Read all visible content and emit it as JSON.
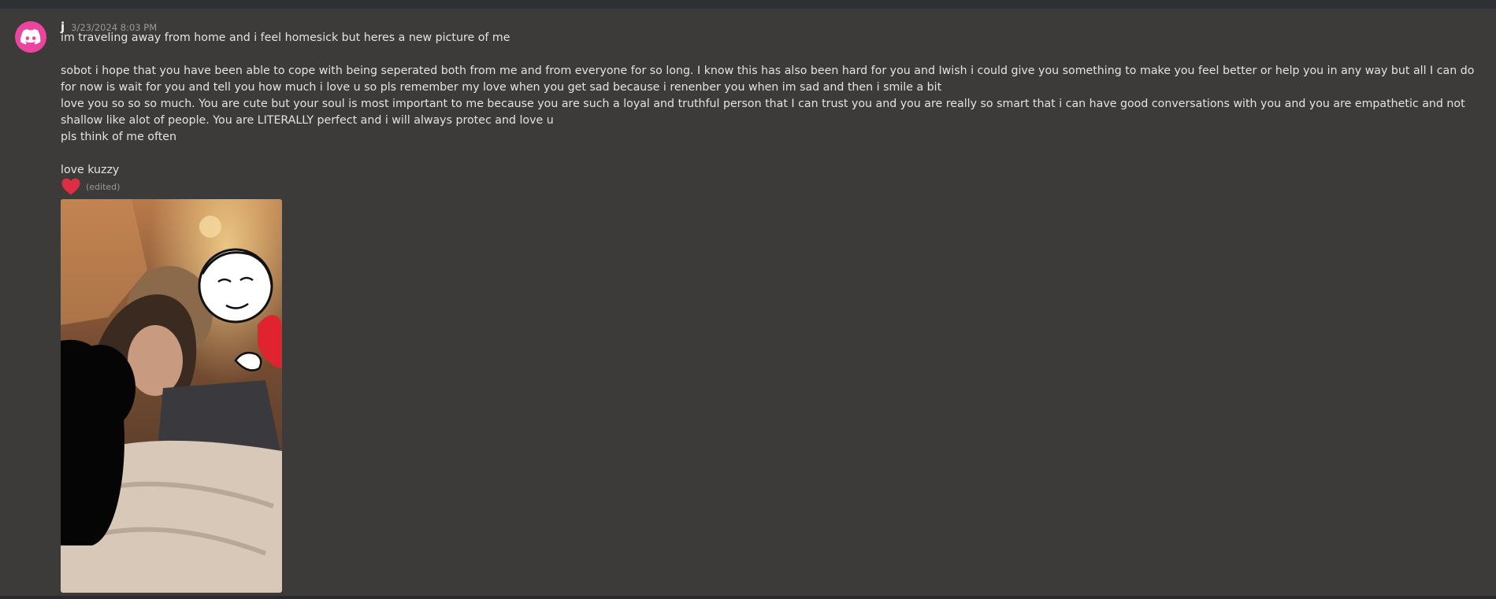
{
  "message": {
    "author": "j",
    "timestamp": "3/23/2024 8:03 PM",
    "lines": [
      "im traveling away from home and i feel homesick but heres a new picture of me",
      "",
      "sobot i hope that you have been able to cope with being seperated both from me and from everyone for so long. I know this has also been hard for you and Iwish i could give you something to make you feel better or help you in any way but all I can do for now is wait for you and tell you how much i love u so pls remember my love when you get sad because i renenber you when im sad and then i smile a bit",
      "love you so so so much. You are cute but your soul is most important to me because you are such a loyal and truthful person that I can trust you and you are really so smart that i can have good conversations with you and you are empathetic and not shallow like alot of people. You are LITERALLY perfect and i will always protec and love u",
      "pls think of me often",
      "",
      "love kuzzy"
    ],
    "reaction_icon": "red-heart-emoji",
    "edited_label": "(edited)",
    "attachment_icon": "photo-attachment"
  },
  "colors": {
    "background": "#3c3b39",
    "avatar": "#eb459f",
    "text": "#e3e3e3",
    "muted": "#9a9a9a",
    "heart": "#dd2e44"
  }
}
